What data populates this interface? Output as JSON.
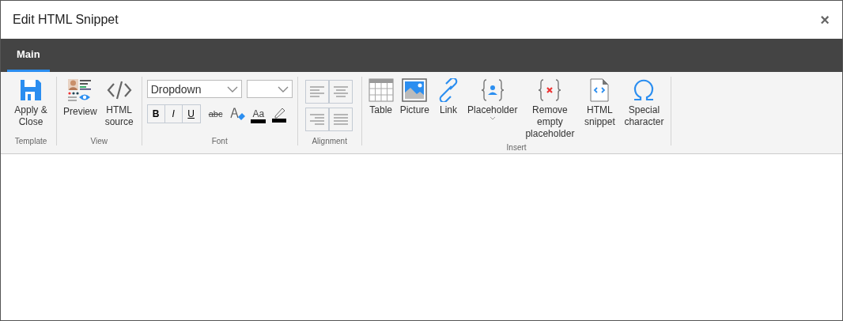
{
  "window": {
    "title": "Edit HTML Snippet",
    "close": "×"
  },
  "tabs": [
    {
      "label": "Main",
      "selected": true
    }
  ],
  "ribbon": {
    "template": {
      "label": "Template",
      "apply": "Apply & Close"
    },
    "view": {
      "label": "View",
      "preview": "Preview",
      "source": "HTML source"
    },
    "font": {
      "label": "Font",
      "family": "Dropdown",
      "bold": "B",
      "italic": "I",
      "underline": "U",
      "strike": "abc",
      "font_color": "Aa"
    },
    "alignment": {
      "label": "Alignment"
    },
    "insert": {
      "label": "Insert",
      "items": [
        {
          "label": "Table",
          "kind": "table"
        },
        {
          "label": "Picture",
          "kind": "picture"
        },
        {
          "label": "Link",
          "kind": "link"
        },
        {
          "label": "Placeholder",
          "kind": "placeholder",
          "dropdown": true
        },
        {
          "label": "Remove empty placeholder",
          "kind": "remove"
        },
        {
          "label": "HTML snippet",
          "kind": "snippet"
        },
        {
          "label": "Special character",
          "kind": "omega"
        }
      ]
    }
  }
}
